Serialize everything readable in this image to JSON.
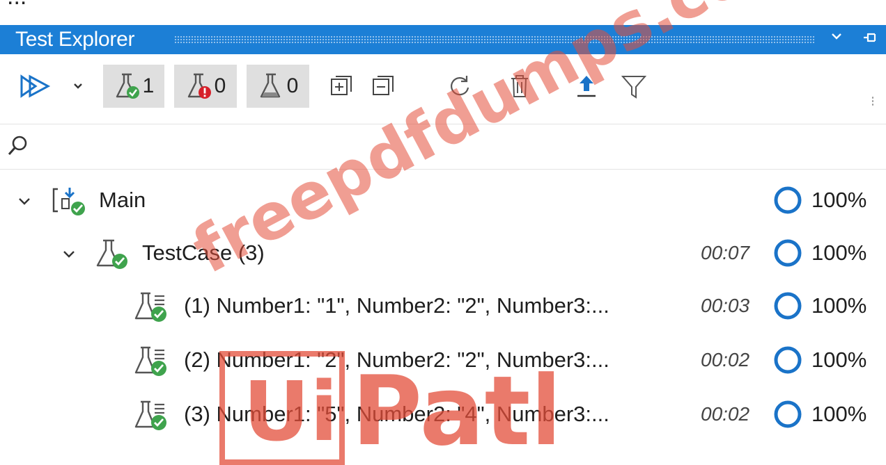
{
  "header_cut_text": "...",
  "panel": {
    "title": "Test Explorer",
    "dropdown_icon": "chevron-down-icon",
    "pin_icon": "pin-icon"
  },
  "toolbar": {
    "run_icon": "run-all-icon",
    "passed_count": "1",
    "failed_count": "0",
    "notrun_count": "0",
    "icons": [
      "expand-all-icon",
      "collapse-all-icon",
      "refresh-icon",
      "delete-icon",
      "export-icon",
      "filter-icon"
    ]
  },
  "search": {
    "icon": "search-icon",
    "value": ""
  },
  "tree": {
    "main": {
      "label": "Main",
      "duration": "",
      "percent": "100%",
      "status": "passed"
    },
    "testcase": {
      "label": "TestCase (3)",
      "duration": "00:07",
      "percent": "100%",
      "status": "passed"
    },
    "items": [
      {
        "label": "(1) Number1: \"1\", Number2: \"2\", Number3:...",
        "duration": "00:03",
        "percent": "100%",
        "status": "passed"
      },
      {
        "label": "(2) Number1: \"2\", Number2: \"2\", Number3:...",
        "duration": "00:02",
        "percent": "100%",
        "status": "passed"
      },
      {
        "label": "(3) Number1: \"5\", Number2: \"4\", Number3:...",
        "duration": "00:02",
        "percent": "100%",
        "status": "passed"
      }
    ]
  },
  "watermark": {
    "site_text": "freepdfdumps.com",
    "logo_text": "UiPath"
  },
  "colors": {
    "titlebar": "#1c7fd6",
    "accent_blue": "#1a73c8",
    "pass_green": "#3fa34d",
    "fail_red": "#d6202a",
    "watermark_red": "#e34e3a"
  }
}
